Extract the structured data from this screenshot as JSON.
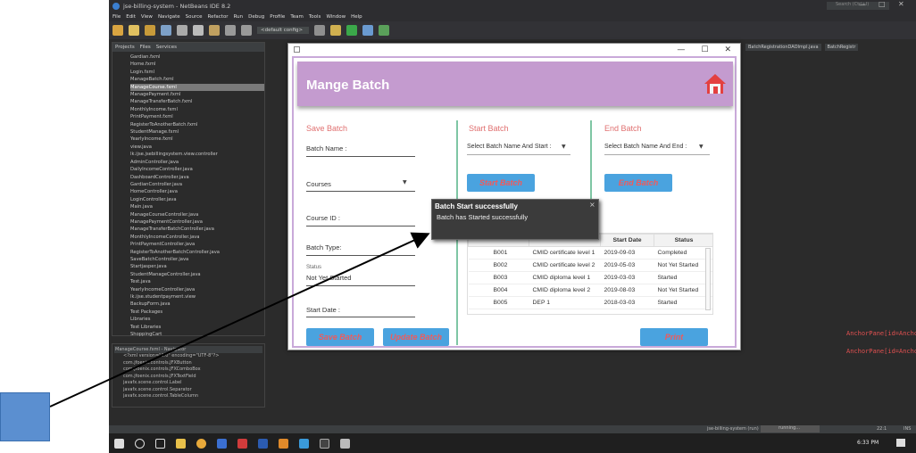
{
  "ide": {
    "title": "jse-billing-system - NetBeans IDE 8.2",
    "search_placeholder": "Search (Ctrl+I)",
    "menu": [
      "File",
      "Edit",
      "View",
      "Navigate",
      "Source",
      "Refactor",
      "Run",
      "Debug",
      "Profile",
      "Team",
      "Tools",
      "Window",
      "Help"
    ],
    "config": "<default config>",
    "panel_tabs": [
      "Projects",
      "Files",
      "Services"
    ],
    "files": [
      "Gardian.fxml",
      "Home.fxml",
      "Login.fxml",
      "ManageBatch.fxml",
      "ManageCourse.fxml",
      "ManagePayment.fxml",
      "ManageTransferBatch.fxml",
      "MonthlyIncome.fxml",
      "PrintPayment.fxml",
      "RegisterToAnotherBatch.fxml",
      "StudentManage.fxml",
      "YearlyIncome.fxml",
      "view.java",
      "lk.ijse.jsebillingsystem.view.controller",
      "AdminController.java",
      "DailyIncomeController.java",
      "DashboardController.java",
      "GardianController.java",
      "HomeController.java",
      "LoginController.java",
      "Main.java",
      "ManageCourseController.java",
      "ManagePaymentController.java",
      "ManageTransferBatchController.java",
      "MonthlyIncomeController.java",
      "PrintPaymentController.java",
      "RegisterToAnotherBatchController.java",
      "SaveBatchController.java",
      "Startjasper.java",
      "StudentManageController.java",
      "Test.java",
      "YearlyIncomeController.java",
      "lk.ijse.studentpayment.view",
      "BackupForm.java",
      "Test Packages",
      "Libraries",
      "Test Libraries",
      "ShoppingCart"
    ],
    "navigator_title": "ManageCourse.fxml - Navigator",
    "navigator_items": [
      "<?xml version=\"1.0\" encoding=\"UTF-8\"?>",
      "com.jfoenix.controls.JFXButton",
      "com.jfoenix.controls.JFXComboBox",
      "com.jfoenix.controls.JFXTextField",
      "javafx.scene.control.Label",
      "javafx.scene.control.Separator",
      "javafx.scene.control.TableColumn"
    ],
    "editor_tabs": [
      "BatchRegistrationDAOImpl.java",
      "BatchRegistr"
    ],
    "console_line": "AnchorPane[id=AnchorPane, styleClass=r",
    "status_left": "jse-billing-system (run)",
    "status_right": "running...",
    "line_col": "22:1",
    "ins": "INS",
    "clock": "6:33 PM"
  },
  "app": {
    "title": "Mange Batch",
    "save": {
      "heading": "Save Batch",
      "batch_name": "Batch Name :",
      "courses": "Courses",
      "course_id": "Course ID :",
      "batch_type": "Batch Type:",
      "status_caption": "Status",
      "status_value": "Not Yet Started",
      "start_date": "Start Date :",
      "save_btn": "Save Batch",
      "update_btn": "Update Batch"
    },
    "start": {
      "heading": "Start Batch",
      "select": "Select Batch Name And Start :",
      "btn": "Start Batch"
    },
    "end": {
      "heading": "End Batch",
      "select": "Select Batch Name And End :",
      "btn": "End Batch"
    },
    "table": {
      "columns": [
        "",
        "",
        "Start Date",
        "Status"
      ],
      "rows": [
        [
          "B001",
          "CMID certificate level 1",
          "2019-09-03",
          "Completed"
        ],
        [
          "B002",
          "CMID certificate level 2",
          "2019-05-03",
          "Not Yet Started"
        ],
        [
          "B003",
          "CMID diploma level 1",
          "2019-03-03",
          "Started"
        ],
        [
          "B004",
          "CMID diploma level 2",
          "2019-08-03",
          "Not Yet Started"
        ],
        [
          "B005",
          "DEP 1",
          "2018-03-03",
          "Started"
        ]
      ]
    },
    "print_btn": "Print",
    "toast": {
      "title": "Batch Start successfully",
      "message": "Batch has Started successfully",
      "close": "×"
    }
  },
  "colors": {
    "banner": "#c49bcf",
    "button": "#4aa3df",
    "heading": "#e07070",
    "overlay_square": "#5b8fd0"
  }
}
